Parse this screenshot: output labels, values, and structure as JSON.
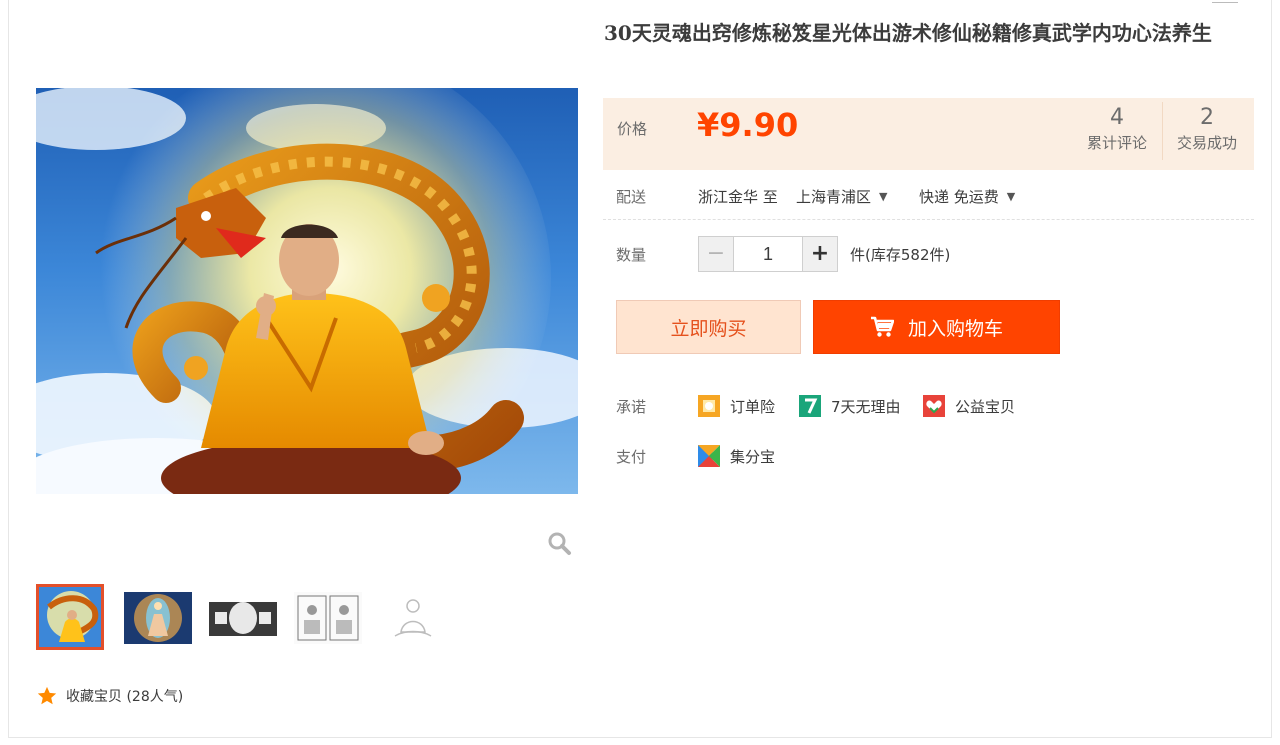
{
  "product": {
    "title": "30天灵魂出窍修炼秘笈星光体出游术修仙秘籍修真武学内功心法养生"
  },
  "price": {
    "label": "价格",
    "value": "¥9.90",
    "stats": [
      {
        "num": "4",
        "label": "累计评论"
      },
      {
        "num": "2",
        "label": "交易成功"
      }
    ],
    "panel_color": "#fbeee2",
    "accent_color": "#ff4400"
  },
  "shipping": {
    "label": "配送",
    "from": "浙江金华 至",
    "to": "上海青浦区",
    "method": "快递 免运费"
  },
  "quantity": {
    "label": "数量",
    "minus": "−",
    "value": "1",
    "plus": "+",
    "stock": "件(库存582件)"
  },
  "buttons": {
    "buy_now": "立即购买",
    "add_cart": "加入购物车"
  },
  "promise": {
    "label": "承诺",
    "items": [
      {
        "icon": "order-insurance-icon",
        "label": "订单险"
      },
      {
        "icon": "seven-day-return-icon",
        "label": "7天无理由"
      },
      {
        "icon": "charity-icon",
        "label": "公益宝贝"
      }
    ]
  },
  "payment": {
    "label": "支付",
    "items": [
      {
        "icon": "jifenbao-icon",
        "label": "集分宝"
      }
    ]
  },
  "favorite": {
    "icon": "star-icon",
    "label": "收藏宝贝 (28人气)"
  },
  "gallery": {
    "thumbnails": [
      "thumb-monk-dragon",
      "thumb-aura-meditation",
      "thumb-calligraphy",
      "thumb-scripture-pages",
      "thumb-meditating-sketch"
    ],
    "active_index": 0
  }
}
